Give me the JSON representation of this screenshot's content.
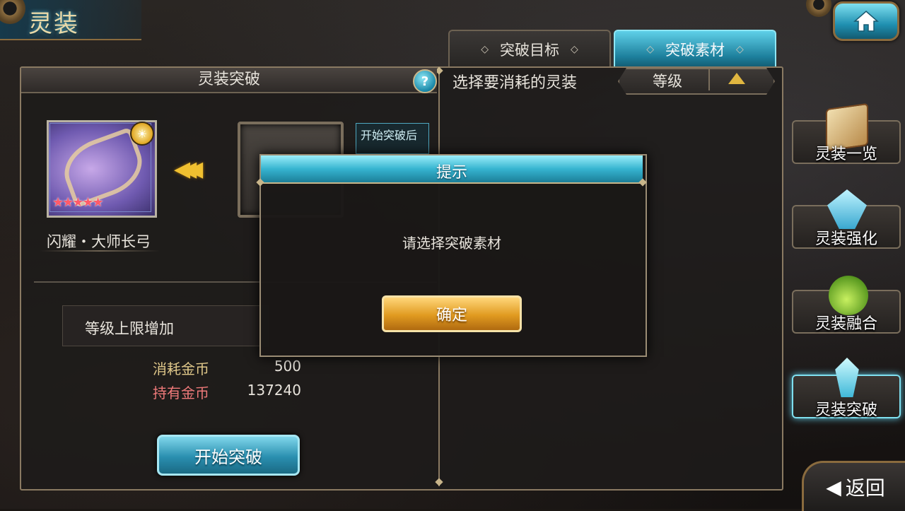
{
  "screen": {
    "title": "灵装"
  },
  "tabs": [
    {
      "label": "突破目标",
      "active": false
    },
    {
      "label": "突破素材",
      "active": true
    }
  ],
  "left_panel": {
    "header": "灵装突破",
    "help_symbol": "?",
    "card": {
      "name": "闪耀・大师长弓",
      "stars": "★★★★★",
      "rarity_stars": 5
    },
    "hint_text": "开始突破后",
    "effect_label": "等级上限增加",
    "cost_label": "消耗金币",
    "cost_value": "500",
    "own_label": "持有金币",
    "own_value": "137240",
    "start_button": "开始突破"
  },
  "right_panel": {
    "header": "选择要消耗的灵装",
    "sort_label": "等级"
  },
  "side_menu": [
    {
      "label": "灵装一览",
      "icon": "book-icon"
    },
    {
      "label": "灵装强化",
      "icon": "crystal-icon"
    },
    {
      "label": "灵装融合",
      "icon": "potion-icon"
    },
    {
      "label": "灵装突破",
      "icon": "shard-icon",
      "active": true
    }
  ],
  "back_button": "返回",
  "modal": {
    "title": "提示",
    "message": "请选择突破素材",
    "ok_label": "确定"
  },
  "colors": {
    "accent_cyan": "#36b4d0",
    "gold": "#e09a20",
    "frame": "#8a7a62"
  }
}
